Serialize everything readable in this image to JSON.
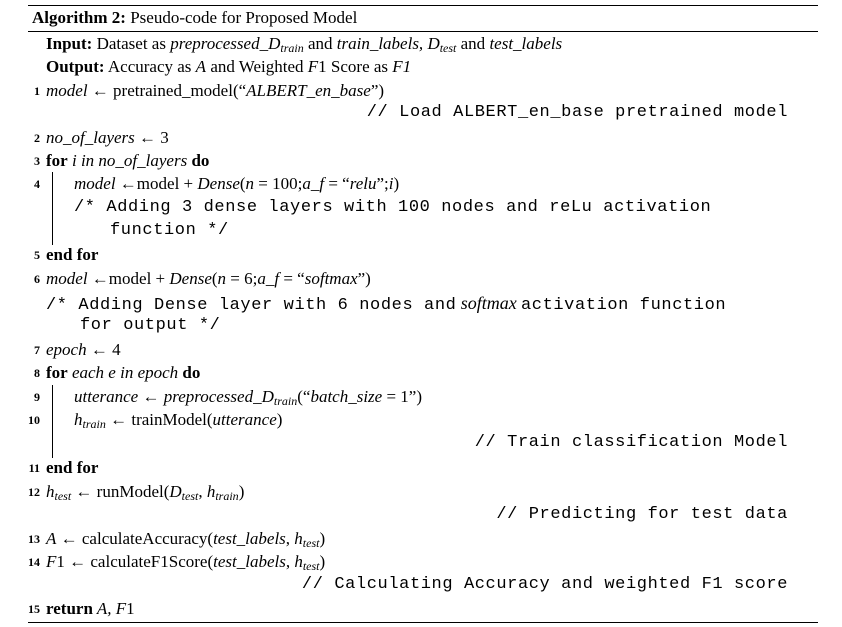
{
  "algorithm": {
    "label": "Algorithm 2:",
    "title": "Pseudo-code for Proposed Model",
    "input_kw": "Input:",
    "input_pre": "Dataset as",
    "input_v1": "preprocessed_D",
    "input_v1_sub": "train",
    "input_and1": "and",
    "input_v2": "train_labels,",
    "input_v3": "D",
    "input_v3_sub": "test",
    "input_and2": "and",
    "input_v4": "test_labels",
    "output_kw": "Output:",
    "output_pre": "Accuracy as",
    "output_v1": "A",
    "output_mid": "and Weighted",
    "output_v2": "F",
    "output_mid2": "1 Score as",
    "output_v3": "F1",
    "lines": {
      "l1": {
        "num": "1",
        "a": "model",
        "b": " ← pretrained_model(“",
        "c": "ALBERT_en_base",
        "d": "”)"
      },
      "l1c": {
        "text": "// Load ALBERT_en_base pretrained model"
      },
      "l2": {
        "num": "2",
        "a": "no_of_layers",
        "b": " ← 3"
      },
      "l3": {
        "num": "3",
        "kw": "for",
        "a": " i in no_of_layers ",
        "kw2": "do"
      },
      "l4": {
        "num": "4",
        "a": "model",
        "b": " ←model + ",
        "c": "Dense",
        "d": "(",
        "e": "n",
        "f": " = 100;",
        "g": "a_f",
        "h": " = “",
        "i": "relu",
        "j": "”;",
        "k": "i",
        "l": ")"
      },
      "l4c1": {
        "text": "/* Adding 3 dense layers with 100 nodes and reLu activation"
      },
      "l4c2": {
        "text": "function */"
      },
      "l5": {
        "num": "5",
        "kw": "end for"
      },
      "l6": {
        "num": "6",
        "a": "model",
        "b": " ←model + ",
        "c": "Dense",
        "d": "(",
        "e": "n",
        "f": " = 6;",
        "g": "a_f",
        "h": " = “",
        "i": "softmax",
        "j": "”)"
      },
      "l6c1a": {
        "text": "/* Adding Dense layer with 6 nodes and"
      },
      "l6c1b": {
        "text": "softmax"
      },
      "l6c1c": {
        "text": "activation function"
      },
      "l6c2": {
        "text": "for output */"
      },
      "l7": {
        "num": "7",
        "a": "epoch",
        "b": " ← 4"
      },
      "l8": {
        "num": "8",
        "kw": "for",
        "a": " each e in epoch ",
        "kw2": "do"
      },
      "l9": {
        "num": "9",
        "a": "utterance",
        "b": " ← ",
        "c": "preprocessed_D",
        "sub": "train",
        "d": "(“",
        "e": "batch_size",
        "f": " = 1”)"
      },
      "l10": {
        "num": "10",
        "a": "h",
        "sub": "train",
        "b": " ← trainModel(",
        "c": "utterance",
        "d": ")"
      },
      "l10c": {
        "text": "// Train classification Model"
      },
      "l11": {
        "num": "11",
        "kw": "end for"
      },
      "l12": {
        "num": "12",
        "a": "h",
        "sub": "test",
        "b": " ← runModel(",
        "c": "D",
        "csub": "test",
        "d": ", ",
        "e": "h",
        "esub": "train",
        "f": ")"
      },
      "l12c": {
        "text": "// Predicting for test data"
      },
      "l13": {
        "num": "13",
        "a": "A",
        "b": " ← calculateAccuracy(",
        "c": "test_labels",
        "d": ", ",
        "e": "h",
        "esub": "test",
        "f": ")"
      },
      "l14": {
        "num": "14",
        "a": "F",
        "b": "1 ← calculateF1Score(",
        "c": "test_labels",
        "d": ", ",
        "e": "h",
        "esub": "test",
        "f": ")"
      },
      "l14c": {
        "text": "// Calculating Accuracy and weighted F1 score"
      },
      "l15": {
        "num": "15",
        "kw": "return",
        "a": " A, F",
        "b": "1"
      }
    }
  }
}
